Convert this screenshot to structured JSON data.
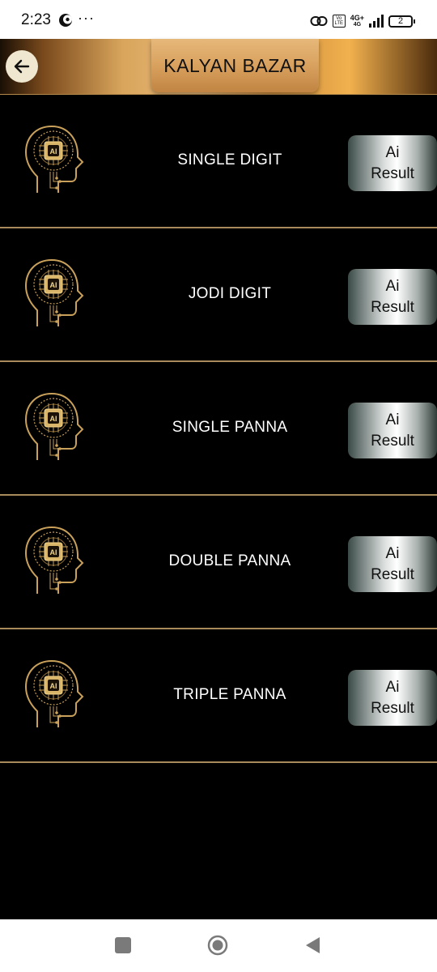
{
  "status_bar": {
    "time": "2:23",
    "more": "···",
    "network_top": "4G+",
    "network_bottom": "4G",
    "volte": "Vo LTE",
    "battery": "2"
  },
  "header": {
    "title": "KALYAN BAZAR",
    "back_icon": "arrow-left-icon"
  },
  "rows": [
    {
      "label": "SINGLE DIGIT",
      "button_line1": "Ai",
      "button_line2": "Result",
      "icon_text": "AI"
    },
    {
      "label": "JODI DIGIT",
      "button_line1": "Ai",
      "button_line2": "Result",
      "icon_text": "AI"
    },
    {
      "label": "SINGLE PANNA",
      "button_line1": "Ai",
      "button_line2": "Result",
      "icon_text": "AI"
    },
    {
      "label": "DOUBLE PANNA",
      "button_line1": "Ai",
      "button_line2": "Result",
      "icon_text": "AI"
    },
    {
      "label": "TRIPLE PANNA",
      "button_line1": "Ai",
      "button_line2": "Result",
      "icon_text": "AI"
    }
  ],
  "nav_bar": {
    "recents_icon": "square-icon",
    "home_icon": "circle-icon",
    "back_icon": "triangle-back-icon"
  },
  "colors": {
    "background": "#000000",
    "gold": "#c9a15a",
    "divider": "#a98a5a",
    "title_text": "#111111",
    "row_text": "#ffffff"
  }
}
